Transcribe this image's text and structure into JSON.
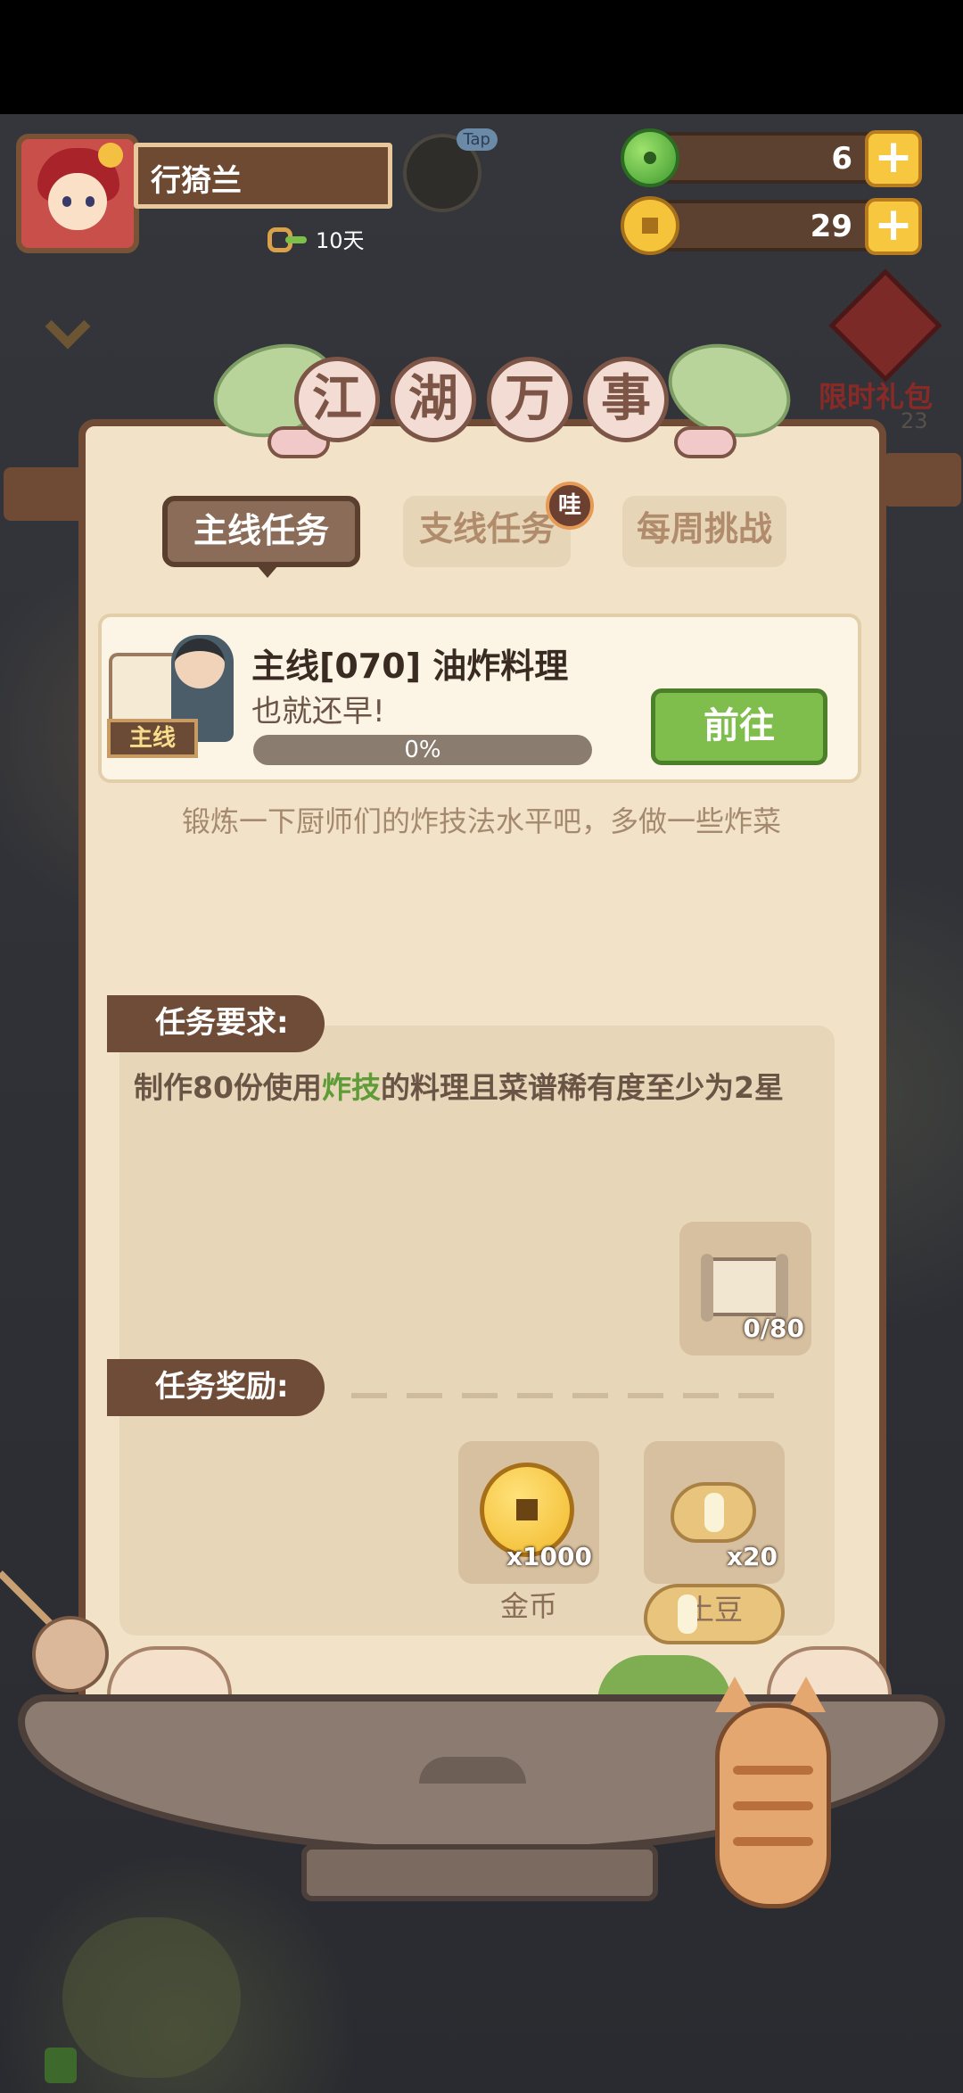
{
  "header": {
    "player_name": "行猗兰",
    "tap_label": "Tap",
    "streak_days": "10天",
    "jade_count": "6",
    "coin_count": "29",
    "gift_label": "限时礼包",
    "gift_timer": "23"
  },
  "panel": {
    "title_chars": [
      "江",
      "湖",
      "万",
      "事"
    ],
    "tabs": [
      {
        "label": "主线任务",
        "active": true
      },
      {
        "label": "支线任务",
        "active": false
      },
      {
        "label": "每周挑战",
        "active": false
      }
    ],
    "tab_badge": "哇",
    "quest": {
      "tag": "主线",
      "title": "主线[070] 油炸料理",
      "subtitle": "也就还早!",
      "progress_percent": 0,
      "progress_label": "0%",
      "go_label": "前往"
    },
    "description": "锻炼一下厨师们的炸技法水平吧，多做一些炸菜",
    "requirement": {
      "header": "任务要求:",
      "text_before": "制作80份使用",
      "text_highlight": "炸技",
      "text_after": "的料理且菜谱稀有度至少为2星",
      "item_count": "0/80"
    },
    "reward": {
      "header": "任务奖励:",
      "items": [
        {
          "name": "金币",
          "count": "x1000",
          "icon": "gold-coin-icon"
        },
        {
          "name": "土豆",
          "count": "x20",
          "icon": "potato-icon"
        }
      ]
    }
  },
  "colors": {
    "panel_bg": "#f2e3c8",
    "panel_border": "#6f4a34",
    "accent_green": "#7fbd4c",
    "highlight_green": "#5e9c38"
  }
}
